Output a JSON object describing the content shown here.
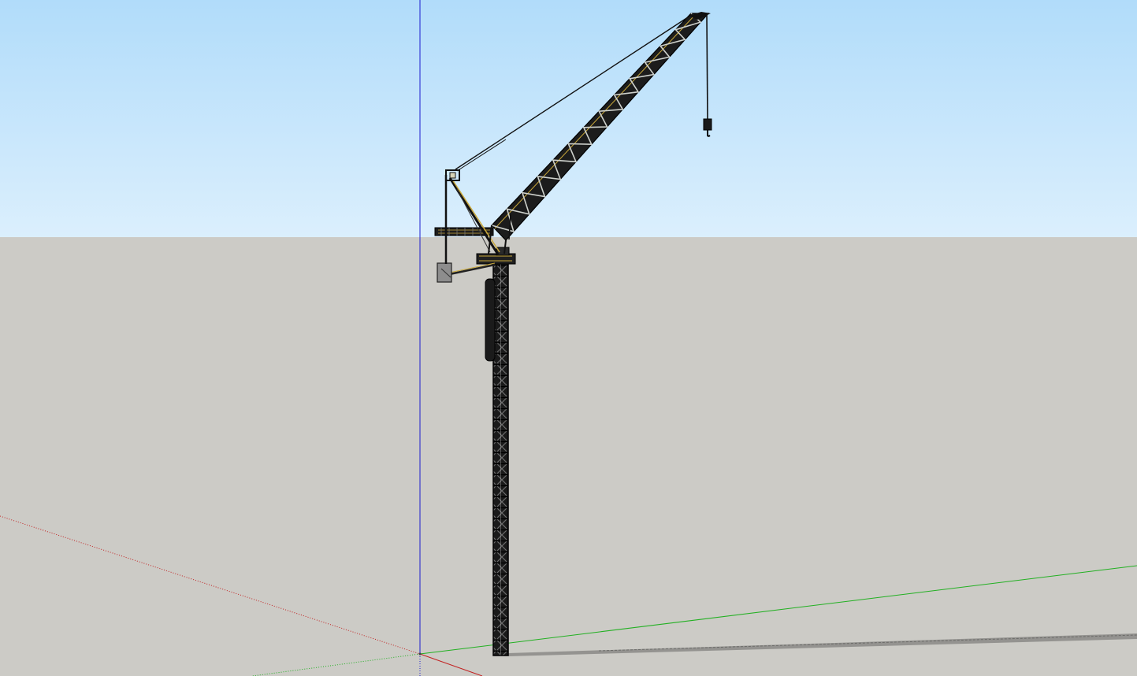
{
  "scene": {
    "sky_top_color": "#b1dcfa",
    "sky_bottom_color": "#dbeffd",
    "ground_color": "#cccbc6",
    "axis_red_color": "#c22121",
    "axis_green_color": "#22b022",
    "axis_blue_color": "#1d1dcf",
    "model_stroke_color": "#111111",
    "model_accent_color": "#c9a83a",
    "shadow_color": "#8a8a86",
    "icons": [
      "axis-origin-icon"
    ]
  }
}
